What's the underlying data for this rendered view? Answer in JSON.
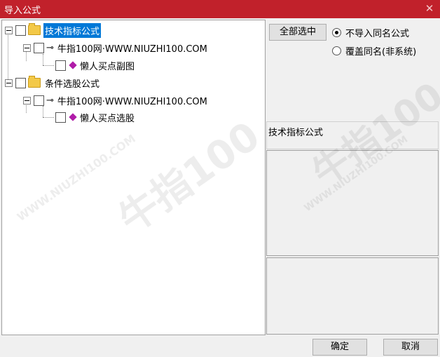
{
  "window": {
    "title": "导入公式",
    "close_symbol": "✕"
  },
  "tree": {
    "items": [
      {
        "label": "技术指标公式"
      },
      {
        "label": "牛指100网·WWW.NIUZHI100.COM"
      },
      {
        "label": "懒人买点副图"
      },
      {
        "label": "条件选股公式"
      },
      {
        "label": "牛指100网·WWW.NIUZHI100.COM"
      },
      {
        "label": "懒人买点选股"
      }
    ]
  },
  "right": {
    "select_all_label": "全部选中",
    "radio_no_import": "不导入同名公式",
    "radio_overwrite": "覆盖同名(非系统)",
    "category_label": "技术指标公式"
  },
  "buttons": {
    "ok": "确定",
    "cancel": "取消"
  },
  "watermark": {
    "main": "牛指100",
    "url": "WWW.NIUZHI100.COM"
  }
}
